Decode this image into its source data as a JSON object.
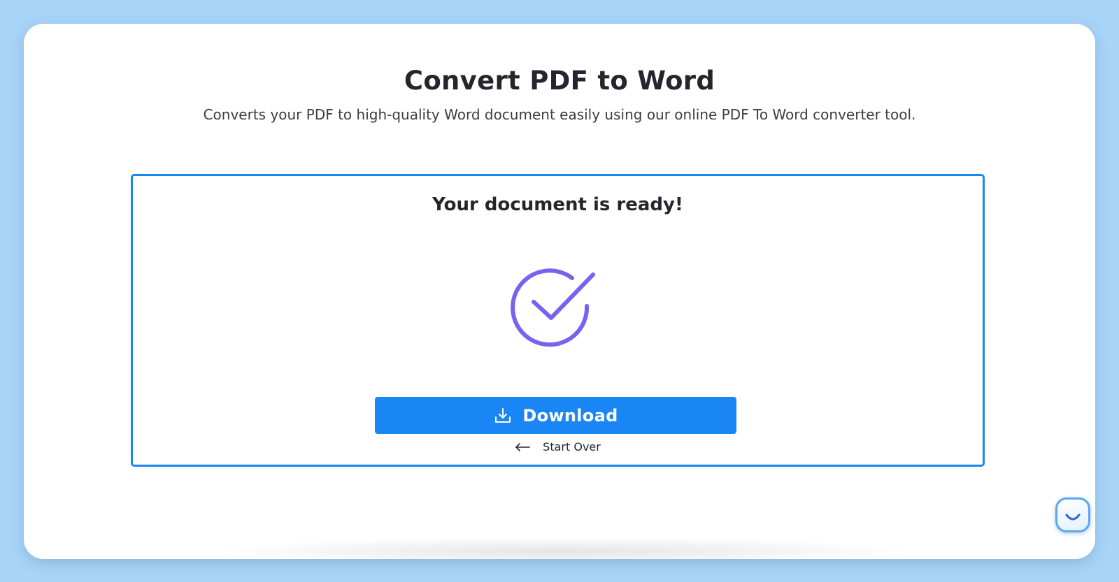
{
  "header": {
    "title": "Convert PDF to Word",
    "subtitle": "Converts your PDF to high-quality Word document easily using our online PDF To Word converter tool."
  },
  "result": {
    "heading": "Your document is ready!",
    "status_icon": "check-circle-icon",
    "download_label": "Download",
    "download_icon": "download-icon",
    "start_over_label": "Start Over",
    "start_over_icon": "arrow-left-icon"
  },
  "chat_widget": {
    "icon": "chat-smile-icon"
  },
  "colors": {
    "accent": "#1a86f6",
    "check": "#7b61f0",
    "background": "#a8d4f7"
  }
}
